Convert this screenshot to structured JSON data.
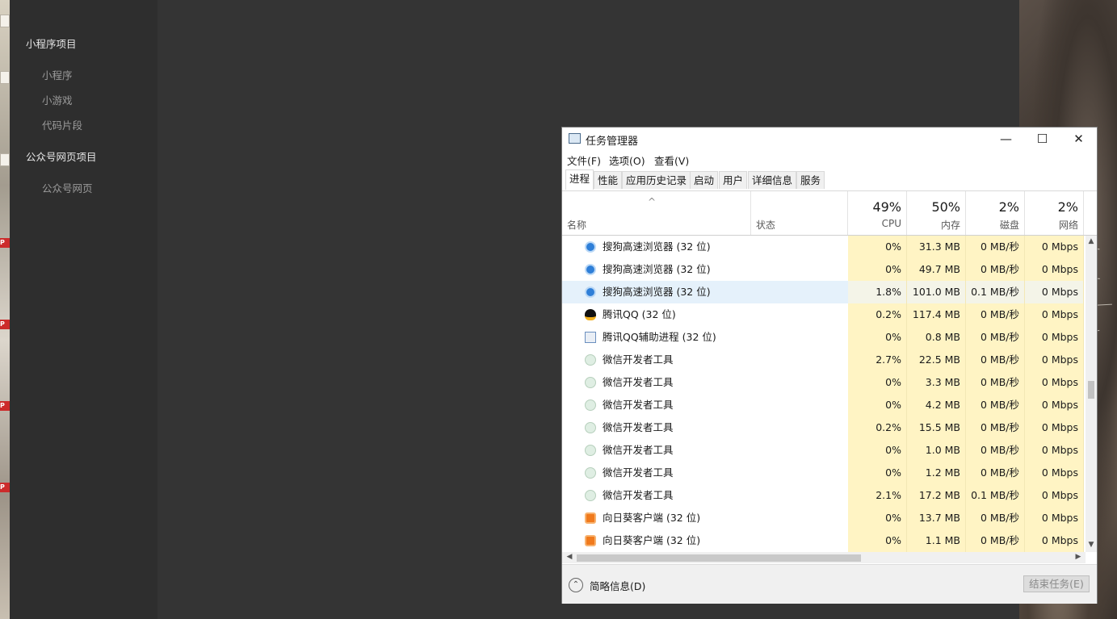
{
  "sidebar": {
    "groups": [
      {
        "title": "小程序项目",
        "items": [
          "小程序",
          "小游戏",
          "代码片段"
        ]
      },
      {
        "title": "公众号网页项目",
        "items": [
          "公众号网页"
        ]
      }
    ]
  },
  "task_manager": {
    "title": "任务管理器",
    "window_controls": {
      "minimize": "—",
      "maximize": "☐",
      "close": "✕"
    },
    "menu": [
      "文件(F)",
      "选项(O)",
      "查看(V)"
    ],
    "tabs": [
      "进程",
      "性能",
      "应用历史记录",
      "启动",
      "用户",
      "详细信息",
      "服务"
    ],
    "active_tab": "进程",
    "columns": {
      "name": "名称",
      "status": "状态",
      "cpu": {
        "pct": "49%",
        "label": "CPU"
      },
      "mem": {
        "pct": "50%",
        "label": "内存"
      },
      "disk": {
        "pct": "2%",
        "label": "磁盘"
      },
      "net": {
        "pct": "2%",
        "label": "网络"
      }
    },
    "rows": [
      {
        "icon": "sogou-browser-icon",
        "name": "搜狗高速浏览器 (32 位)",
        "cpu": "0%",
        "mem": "31.3 MB",
        "disk": "0 MB/秒",
        "net": "0 Mbps"
      },
      {
        "icon": "sogou-browser-icon",
        "name": "搜狗高速浏览器 (32 位)",
        "cpu": "0%",
        "mem": "49.7 MB",
        "disk": "0 MB/秒",
        "net": "0 Mbps"
      },
      {
        "icon": "sogou-browser-icon",
        "name": "搜狗高速浏览器 (32 位)",
        "cpu": "1.8%",
        "mem": "101.0 MB",
        "disk": "0.1 MB/秒",
        "net": "0 Mbps",
        "highlighted": true
      },
      {
        "icon": "qq-penguin-icon",
        "name": "腾讯QQ (32 位)",
        "cpu": "0.2%",
        "mem": "117.4 MB",
        "disk": "0 MB/秒",
        "net": "0 Mbps"
      },
      {
        "icon": "qq-helper-icon",
        "name": "腾讯QQ辅助进程 (32 位)",
        "cpu": "0%",
        "mem": "0.8 MB",
        "disk": "0 MB/秒",
        "net": "0 Mbps"
      },
      {
        "icon": "wechat-devtools-icon",
        "name": "微信开发者工具",
        "cpu": "2.7%",
        "mem": "22.5 MB",
        "disk": "0 MB/秒",
        "net": "0 Mbps"
      },
      {
        "icon": "wechat-devtools-icon",
        "name": "微信开发者工具",
        "cpu": "0%",
        "mem": "3.3 MB",
        "disk": "0 MB/秒",
        "net": "0 Mbps"
      },
      {
        "icon": "wechat-devtools-icon",
        "name": "微信开发者工具",
        "cpu": "0%",
        "mem": "4.2 MB",
        "disk": "0 MB/秒",
        "net": "0 Mbps"
      },
      {
        "icon": "wechat-devtools-icon",
        "name": "微信开发者工具",
        "cpu": "0.2%",
        "mem": "15.5 MB",
        "disk": "0 MB/秒",
        "net": "0 Mbps"
      },
      {
        "icon": "wechat-devtools-icon",
        "name": "微信开发者工具",
        "cpu": "0%",
        "mem": "1.0 MB",
        "disk": "0 MB/秒",
        "net": "0 Mbps"
      },
      {
        "icon": "wechat-devtools-icon",
        "name": "微信开发者工具",
        "cpu": "0%",
        "mem": "1.2 MB",
        "disk": "0 MB/秒",
        "net": "0 Mbps"
      },
      {
        "icon": "wechat-devtools-icon",
        "name": "微信开发者工具",
        "cpu": "2.1%",
        "mem": "17.2 MB",
        "disk": "0.1 MB/秒",
        "net": "0 Mbps"
      },
      {
        "icon": "sunflower-client-icon",
        "name": "向日葵客户端 (32 位)",
        "cpu": "0%",
        "mem": "13.7 MB",
        "disk": "0 MB/秒",
        "net": "0 Mbps"
      },
      {
        "icon": "sunflower-client-icon",
        "name": "向日葵客户端 (32 位)",
        "cpu": "0%",
        "mem": "1.1 MB",
        "disk": "0 MB/秒",
        "net": "0 Mbps"
      }
    ],
    "footer": {
      "collapse_label": "简略信息(D)",
      "end_task": "结束任务(E)"
    }
  }
}
